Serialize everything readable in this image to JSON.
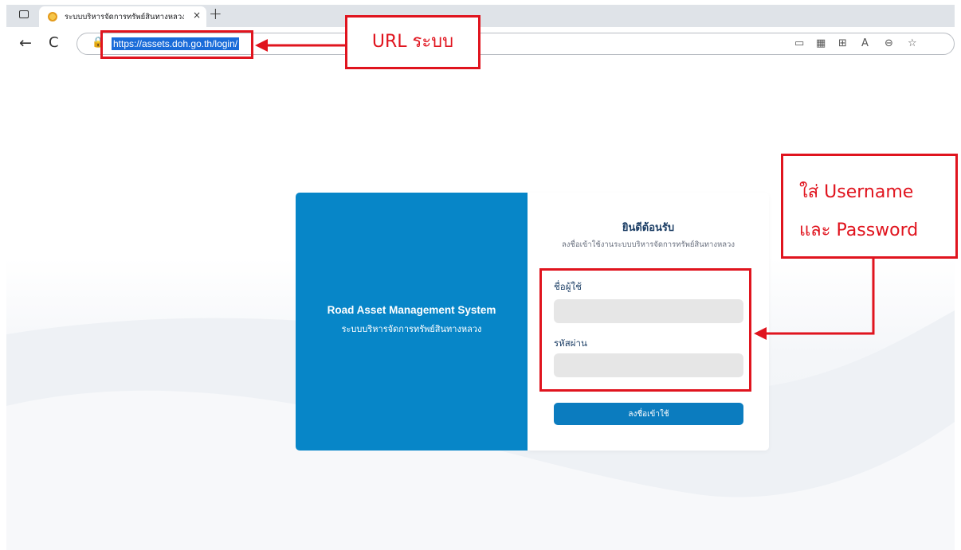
{
  "browser": {
    "tab_title": "ระบบบริหารจัดการทรัพย์สินทางหลวง -",
    "tab_close": "×",
    "new_tab": "+",
    "back": "←",
    "reload": "C",
    "url": "https://assets.doh.go.th/login/",
    "toolbar_icons": [
      "cast-icon",
      "qr-code-icon",
      "apps-icon",
      "read-aloud-icon",
      "zoom-icon",
      "favorites-icon"
    ]
  },
  "hero": {
    "title": "Road Asset Management System",
    "subtitle": "ระบบบริหารจัดการทรัพย์สินทางหลวง"
  },
  "login": {
    "welcome": "ยินดีต้อนรับ",
    "welcome_sub": "ลงชื่อเข้าใช้งานระบบบริหารจัดการทรัพย์สินทางหลวง",
    "username_label": "ชื่อผู้ใช้",
    "username_value": "",
    "password_label": "รหัสผ่าน",
    "password_value": "",
    "submit_label": "ลงชื่อเข้าใช้"
  },
  "annotations": {
    "url_callout": "URL ระบบ",
    "credentials_line1": "ใส่ Username",
    "credentials_line2": "และ Password",
    "color": "#e0141e"
  },
  "colors": {
    "brand_blue": "#0786c8",
    "button_blue": "#0b7cbf",
    "heading_navy": "#1d3f66"
  }
}
